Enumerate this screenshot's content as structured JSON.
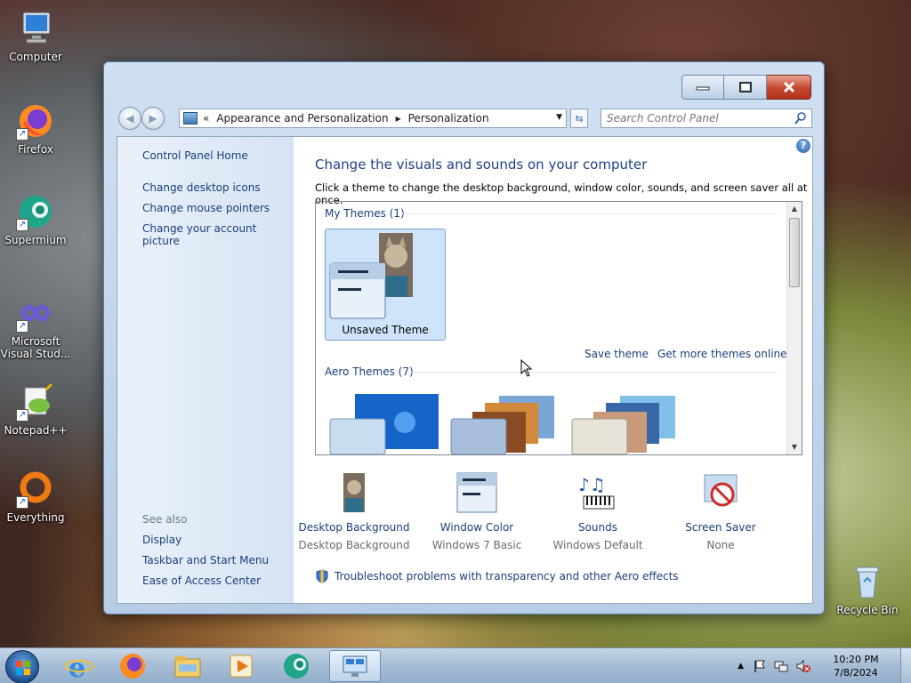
{
  "desktop": {
    "icons": [
      {
        "label": "Computer",
        "icon": "computer-icon"
      },
      {
        "label": "Firefox",
        "icon": "firefox-icon"
      },
      {
        "label": "Supermium",
        "icon": "supermium-icon"
      },
      {
        "label": "Microsoft Visual Stud...",
        "icon": "vscode-icon"
      },
      {
        "label": "Notepad++",
        "icon": "notepadpp-icon"
      },
      {
        "label": "Everything",
        "icon": "everything-icon"
      }
    ],
    "recycle_bin": "Recycle Bin"
  },
  "window": {
    "breadcrumb": {
      "prefix": "«",
      "segments": [
        "Appearance and Personalization",
        "Personalization"
      ]
    },
    "search_placeholder": "Search Control Panel",
    "help_label": "?"
  },
  "left_pane": {
    "home": "Control Panel Home",
    "links": [
      "Change desktop icons",
      "Change mouse pointers",
      "Change your account picture"
    ],
    "see_also_title": "See also",
    "see_also": [
      "Display",
      "Taskbar and Start Menu",
      "Ease of Access Center"
    ]
  },
  "main": {
    "title": "Change the visuals and sounds on your computer",
    "subtitle": "Click a theme to change the desktop background, window color, sounds, and screen saver all at once.",
    "my_themes_header": "My Themes (1)",
    "unsaved_theme": "Unsaved Theme",
    "save_theme": "Save theme",
    "get_more_themes": "Get more themes online",
    "aero_themes_header": "Aero Themes (7)",
    "settings": [
      {
        "title": "Desktop Background",
        "value": "Desktop Background",
        "icon": "desktop-background-icon"
      },
      {
        "title": "Window Color",
        "value": "Windows 7 Basic",
        "icon": "window-color-icon"
      },
      {
        "title": "Sounds",
        "value": "Windows Default",
        "icon": "sounds-icon"
      },
      {
        "title": "Screen Saver",
        "value": "None",
        "icon": "screen-saver-icon"
      }
    ],
    "troubleshoot": "Troubleshoot problems with transparency and other Aero effects"
  },
  "taskbar": {
    "clock_time": "10:20 PM",
    "clock_date": "7/8/2024"
  },
  "colors": {
    "link": "#1b3f7a",
    "heading": "#1e3f8a",
    "close_button": "#c5452c"
  }
}
